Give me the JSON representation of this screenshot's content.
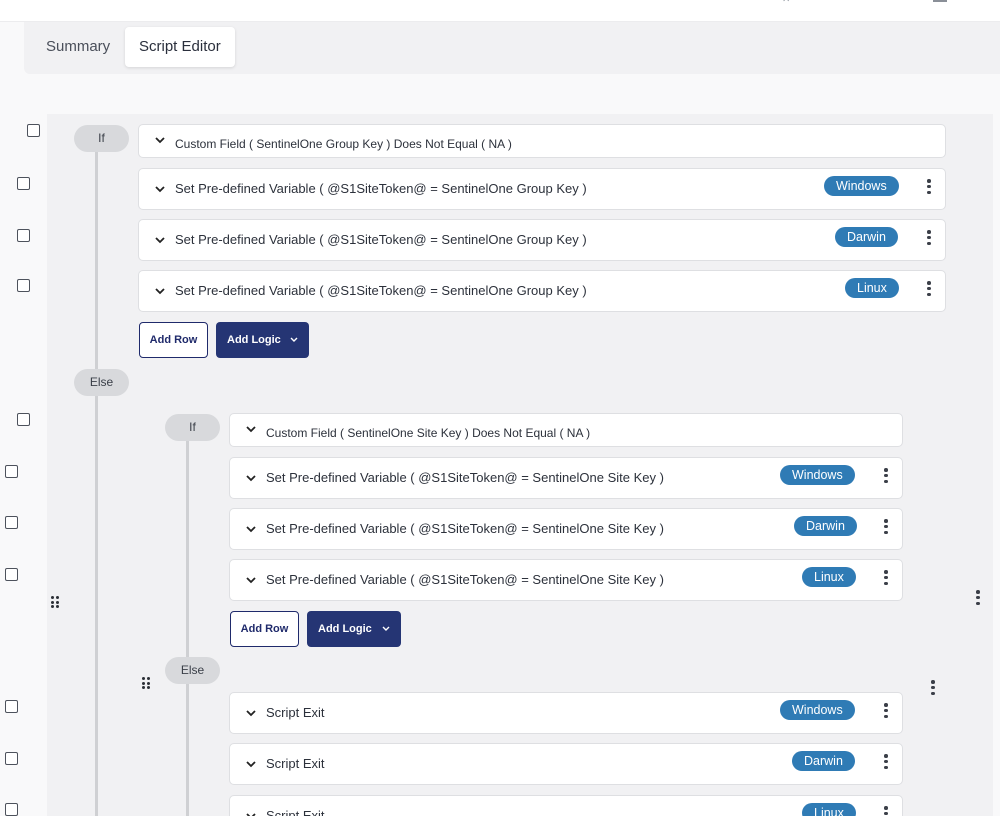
{
  "tabs": {
    "summary": "Summary",
    "script_editor": "Script Editor",
    "active": "script_editor"
  },
  "logic": {
    "if_label": "If",
    "else_label": "Else"
  },
  "outer_condition": "Custom Field ( SentinelOne Group Key ) Does Not Equal ( NA )",
  "outer_actions": [
    {
      "text": "Set Pre-defined Variable ( @S1SiteToken@ = SentinelOne Group Key )",
      "os": "Windows"
    },
    {
      "text": "Set Pre-defined Variable ( @S1SiteToken@ = SentinelOne Group Key )",
      "os": "Darwin"
    },
    {
      "text": "Set Pre-defined Variable ( @S1SiteToken@ = SentinelOne Group Key )",
      "os": "Linux"
    }
  ],
  "inner_condition": "Custom Field ( SentinelOne Site Key ) Does Not Equal ( NA )",
  "inner_actions": [
    {
      "text": "Set Pre-defined Variable ( @S1SiteToken@ = SentinelOne Site Key )",
      "os": "Windows"
    },
    {
      "text": "Set Pre-defined Variable ( @S1SiteToken@ = SentinelOne Site Key )",
      "os": "Darwin"
    },
    {
      "text": "Set Pre-defined Variable ( @S1SiteToken@ = SentinelOne Site Key )",
      "os": "Linux"
    }
  ],
  "else_actions": [
    {
      "text": "Script Exit",
      "os": "Windows"
    },
    {
      "text": "Script Exit",
      "os": "Darwin"
    },
    {
      "text": "Script Exit",
      "os": "Linux"
    }
  ],
  "buttons": {
    "add_row": "Add Row",
    "add_logic": "Add Logic"
  },
  "colors": {
    "badge": "#2f7bb5",
    "add_logic_bg": "#253574",
    "add_row_border": "#1f2a6b"
  }
}
